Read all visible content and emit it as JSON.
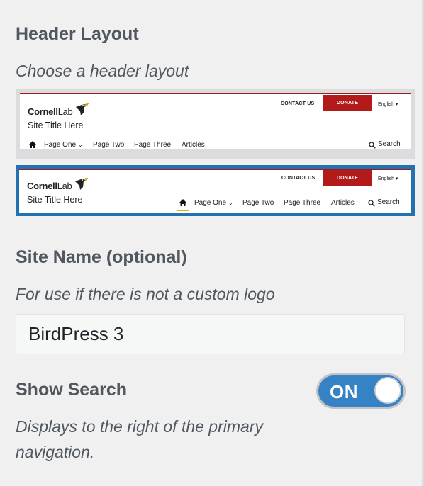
{
  "header_layout": {
    "title": "Header Layout",
    "description": "Choose a header layout",
    "option1": {
      "contact": "CONTACT US",
      "donate": "DONATE",
      "lang": "English ▾",
      "logo_bold": "Cornell",
      "logo_light": "Lab",
      "site_title": "Site Title Here",
      "nav": [
        "Page One",
        "Page Two",
        "Page Three",
        "Articles"
      ],
      "search": "Search"
    },
    "option2": {
      "contact": "CONTACT US",
      "donate": "DONATE",
      "lang": "English ▾",
      "logo_bold": "Cornell",
      "logo_light": "Lab",
      "site_title": "Site Title Here",
      "nav": [
        "Page One",
        "Page Two",
        "Page Three",
        "Articles"
      ],
      "search": "Search"
    },
    "selected_option": 2
  },
  "site_name": {
    "title": "Site Name (optional)",
    "description": "For use if there is not a custom logo",
    "value": "BirdPress 3"
  },
  "show_search": {
    "title": "Show Search",
    "toggle_label": "ON",
    "description_line1": "Displays to the right of the primary",
    "description_line2": "navigation."
  },
  "colors": {
    "accent": "#2271b1",
    "toggle_on": "#3582c4",
    "donate_red": "#b31b1b",
    "home_underline": "#e0b100"
  }
}
